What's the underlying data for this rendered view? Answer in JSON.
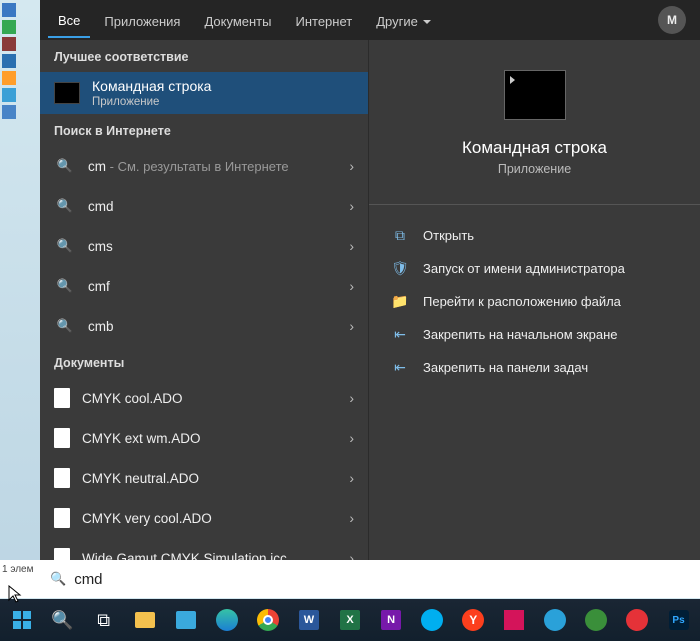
{
  "tabs": {
    "all": "Все",
    "apps": "Приложения",
    "docs": "Документы",
    "web": "Интернет",
    "more": "Другие"
  },
  "avatar": {
    "letter": "М"
  },
  "sections": {
    "best_match": "Лучшее соответствие",
    "web_search": "Поиск в Интернете",
    "documents": "Документы"
  },
  "best": {
    "title": "Командная строка",
    "sub": "Приложение"
  },
  "web_items": [
    {
      "query": "cm",
      "hint": "См. результаты в Интернете"
    },
    {
      "query": "cmd"
    },
    {
      "query": "cms"
    },
    {
      "query": "cmf"
    },
    {
      "query": "cmb"
    }
  ],
  "doc_items": [
    {
      "name": "CMYK cool.ADO"
    },
    {
      "name": "CMYK ext wm.ADO"
    },
    {
      "name": "CMYK neutral.ADO"
    },
    {
      "name": "CMYK very cool.ADO"
    },
    {
      "name": "Wide Gamut CMYK Simulation.icc"
    }
  ],
  "preview": {
    "title": "Командная строка",
    "sub": "Приложение"
  },
  "actions": {
    "open": "Открыть",
    "run_admin": "Запуск от имени администратора",
    "open_loc": "Перейти к расположению файла",
    "pin_start": "Закрепить на начальном экране",
    "pin_taskbar": "Закрепить на панели задач"
  },
  "search": {
    "value": "cmd"
  },
  "footer_text": "1 элем",
  "hint_sep": " - "
}
